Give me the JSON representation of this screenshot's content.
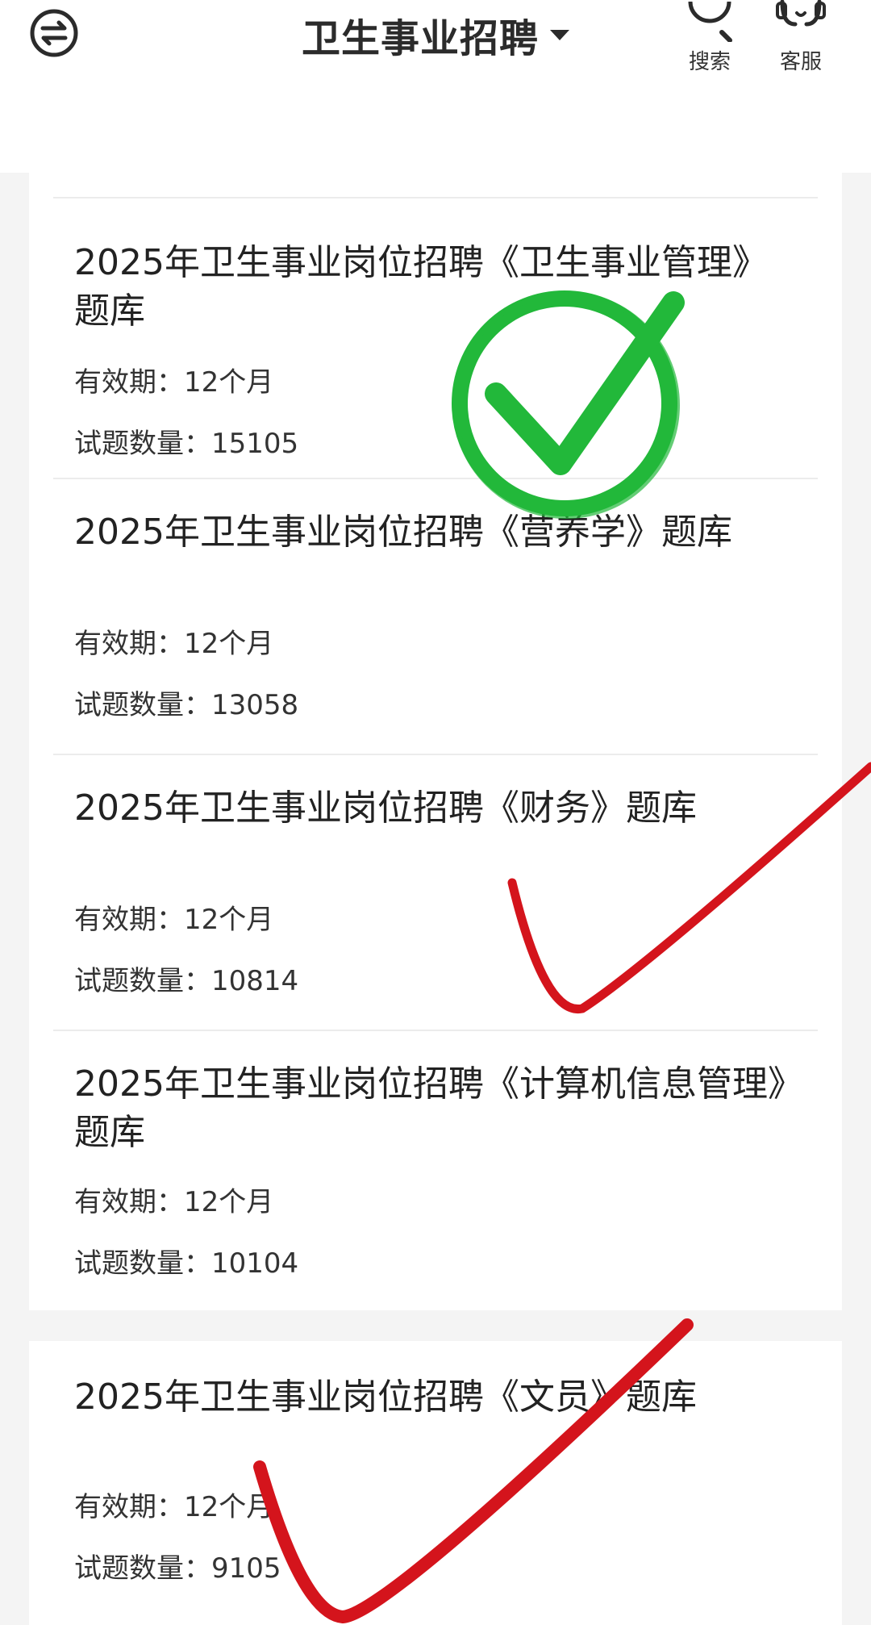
{
  "header": {
    "title": "卫生事业招聘",
    "search_label": "搜索",
    "service_label": "客服"
  },
  "items": [
    {
      "title": "2025年卫生事业岗位招聘《卫生事业管理》题库",
      "validity_label": "有效期：",
      "validity": "12个月",
      "count_label": "试题数量：",
      "count": "15105"
    },
    {
      "title": "2025年卫生事业岗位招聘《营养学》题库",
      "validity_label": "有效期：",
      "validity": "12个月",
      "count_label": "试题数量：",
      "count": "13058"
    },
    {
      "title": "2025年卫生事业岗位招聘《财务》题库",
      "validity_label": "有效期：",
      "validity": "12个月",
      "count_label": "试题数量：",
      "count": "10814"
    },
    {
      "title": "2025年卫生事业岗位招聘《计算机信息管理》题库",
      "validity_label": "有效期：",
      "validity": "12个月",
      "count_label": "试题数量：",
      "count": "10104"
    },
    {
      "title": "2025年卫生事业岗位招聘《文员》题库",
      "validity_label": "有效期：",
      "validity": "12个月",
      "count_label": "试题数量：",
      "count": "9105"
    }
  ],
  "colors": {
    "accent_green": "#22b83a",
    "annotation_red": "#d4141c"
  },
  "icons": [
    "switch-icon",
    "search-icon",
    "headset-icon",
    "caret-down-icon",
    "green-check-circle",
    "red-check-mark"
  ]
}
